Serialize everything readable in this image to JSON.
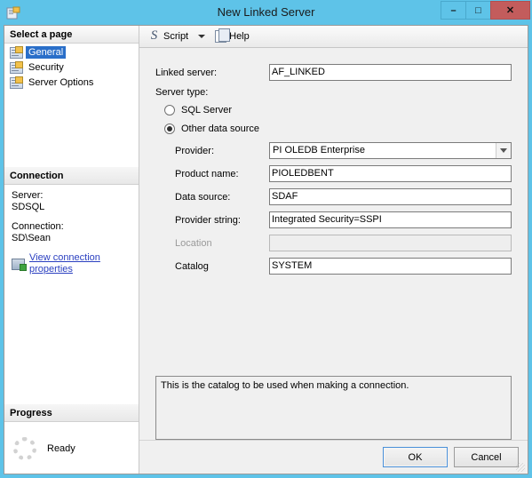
{
  "window": {
    "title": "New Linked Server",
    "icon": "linked-server-icon",
    "buttons": {
      "minimize": "–",
      "maximize": "□",
      "close": "✕"
    }
  },
  "sidebar": {
    "select_page_header": "Select a page",
    "pages": [
      {
        "label": "General",
        "selected": true
      },
      {
        "label": "Security",
        "selected": false
      },
      {
        "label": "Server Options",
        "selected": false
      }
    ],
    "connection": {
      "header": "Connection",
      "server_label": "Server:",
      "server_value": "SDSQL",
      "connection_label": "Connection:",
      "connection_value": "SD\\Sean",
      "properties_link": "View connection properties"
    },
    "progress": {
      "header": "Progress",
      "status": "Ready"
    }
  },
  "toolbar": {
    "script_label": "Script",
    "help_label": "Help"
  },
  "form": {
    "linked_server_label": "Linked server:",
    "linked_server_value": "AF_LINKED",
    "server_type_label": "Server type:",
    "radio_sql_server": "SQL Server",
    "radio_other_data_source": "Other data source",
    "selected_server_type": "other",
    "provider_label": "Provider:",
    "provider_value": "PI OLEDB Enterprise",
    "product_name_label": "Product name:",
    "product_name_value": "PIOLEDBENT",
    "data_source_label": "Data source:",
    "data_source_value": "SDAF",
    "provider_string_label": "Provider string:",
    "provider_string_value": "Integrated Security=SSPI",
    "location_label": "Location",
    "location_value": "",
    "catalog_label": "Catalog",
    "catalog_value": "SYSTEM"
  },
  "help_text": "This is the catalog to be used when making a connection.",
  "footer": {
    "ok_label": "OK",
    "cancel_label": "Cancel"
  },
  "colors": {
    "titlebar": "#5ec3e8",
    "close_button": "#c35c5c",
    "selection": "#2a6fc9",
    "link": "#2a3fc0"
  }
}
